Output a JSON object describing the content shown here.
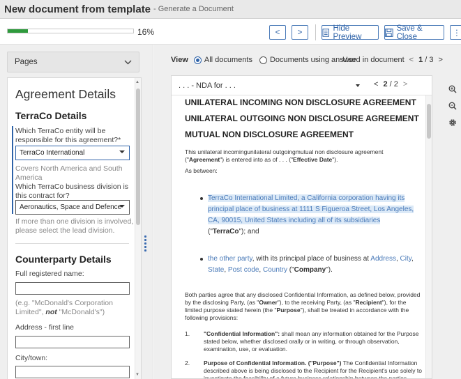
{
  "window": {
    "title": "New document from template",
    "subtitle": "- Generate a Document"
  },
  "toolbar": {
    "progress_value": 0.16,
    "progress_label": "16%",
    "prev_label": "<",
    "next_label": ">",
    "hide_preview_label": "Hide Preview",
    "save_close_label": "Save & Close",
    "more_label": "⋮"
  },
  "left": {
    "pages_label": "Pages",
    "form": {
      "title": "Agreement Details",
      "section1": "TerraCo Details",
      "q1": "Which TerraCo entity will be responsible for this agreement?*",
      "q1_value": "TerraCo International",
      "q1_hint": "Covers North America and South America",
      "q2": "Which TerraCo business division is this contract for?",
      "q2_value": "Aeronautics, Space and Defence",
      "q2_hint": "If more than one division is involved, please select the lead division.",
      "section2": "Counterparty Details",
      "q3": "Full registered name:",
      "q3_hint_pre": "(e.g. \"McDonald's Corporation Limited\",",
      "q3_hint_not": "not",
      "q3_hint_post": "\"McDonald's\")",
      "q4": "Address - first line",
      "q5": "City/town:"
    }
  },
  "right": {
    "view_label": "View",
    "opt_all": "All documents",
    "opt_answer": "Documents using answer",
    "used_label": "Used in document",
    "used_page": "1",
    "used_total": "/ 3",
    "doc_select": ". . . - NDA for . . .",
    "doc_page": "2",
    "doc_total": "/ 2",
    "doc": {
      "h1": "UNILATERAL INCOMING NON DISCLOSURE AGREEMENT",
      "h2": "UNILATERAL OUTGOING NON DISCLOSURE AGREEMENT",
      "h3": "MUTUAL NON DISCLOSURE AGREEMENT",
      "intro_a": "This unilateral incomingunilateral outgoingmutual non disclosure agreement (\"",
      "intro_agreement": "Agreement",
      "intro_b": "\") is entered into as of . . . (\"",
      "intro_date": "Effective Date",
      "intro_c": "\").",
      "as_between": "As between:",
      "party1": "TerraCo International Limited, a California corporation having its principal place of business at 1111 S Figueroa Street, Los Angeles, CA, 90015, United States including all of its subsidiaries",
      "party1_tail_a": "(\"",
      "party1_name": "TerraCo",
      "party1_tail_b": "\"); and",
      "party2_a": "the other party",
      "party2_b": ", with its principal place of business at ",
      "party2_address": "Address",
      "party2_city": "City",
      "party2_state": "State",
      "party2_post": "Post code",
      "party2_country": "Country",
      "party2_c": " (\"",
      "party2_name": "Company",
      "party2_d": "\").",
      "para_a": "Both parties agree that any disclosed Confidential Information, as defined below, provided by the disclosing Party, (as \"",
      "para_owner": "Owner",
      "para_b": "\"), to the receiving Party, (as \"",
      "para_recipient": "Recipient",
      "para_c": "\"), for the limited purpose stated herein (the \"",
      "para_purpose": "Purpose",
      "para_d": "\"), shall be treated in accordance with the following provisions:",
      "item1_num": "1.",
      "item1_title": "\"Confidential Information\":",
      "item1_body": " shall mean any information obtained for the Purpose stated below, whether disclosed orally or in writing, or through observation, examination, use, or evaluation.",
      "item2_num": "2.",
      "item2_title": "Purpose of Confidential Information. (\"Purpose\")",
      "item2_body": " The Confidential Information described above is being disclosed to the Recipient for the Recipient's use solely to investigate the feasibility of a future business relationship between the parties related"
    }
  },
  "colors": {
    "accent": "#2f63a8",
    "progress": "#2e9a3c",
    "highlight": "#dbe9f7"
  }
}
